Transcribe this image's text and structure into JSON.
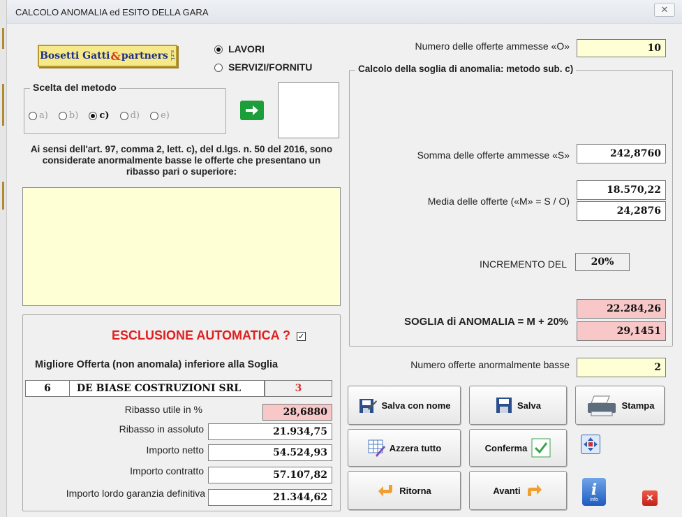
{
  "window": {
    "title": "CALCOLO ANOMALIA ed ESITO DELLA GARA",
    "close_glyph": "✕"
  },
  "logo": {
    "text_main": "Bosetti Gatti",
    "text_amp": "&",
    "text_tail": "partners",
    "text_srl": "s.r.l."
  },
  "tipo": {
    "lavori_label": "LAVORI",
    "servizi_label": "SERVIZI/FORNITU",
    "selected": "LAVORI"
  },
  "metodo": {
    "title": "Scelta del metodo",
    "options": [
      "a)",
      "b)",
      "c)",
      "d)",
      "e)"
    ],
    "selected": "c)"
  },
  "legal_text": "Ai sensi dell'art. 97, comma 2, lett. c), del d.lgs. n. 50 del 2016, sono considerate anormalmente basse le offerte che presentano un ribasso pari o superiore:",
  "esclusione": {
    "title": "ESCLUSIONE AUTOMATICA ?",
    "checked": true,
    "check_glyph": "✓",
    "migliore_label": "Migliore Offerta (non anomala) inferiore alla Soglia",
    "offer_number": "6",
    "company": "DE BIASE COSTRUZIONI SRL",
    "rank": "3",
    "rows": [
      {
        "label": "Ribasso utile in %",
        "value": "28,6880"
      },
      {
        "label": "Ribasso in assoluto",
        "value": "21.934,75"
      },
      {
        "label": "Importo netto",
        "value": "54.524,93"
      },
      {
        "label": "Importo contratto",
        "value": "57.107,82"
      },
      {
        "label": "Importo lordo garanzia definitiva",
        "value": "21.344,62"
      }
    ]
  },
  "right": {
    "numero_offerte_label": "Numero delle offerte ammesse «O»",
    "numero_offerte_value": "10",
    "calc_title": "Calcolo della soglia di anomalia: metodo sub. c)",
    "somma_label": "Somma delle offerte ammesse «S»",
    "somma_value": "242,8760",
    "media_label": "Media delle offerte («M» = S / O)",
    "media_value_1": "18.570,22",
    "media_value_2": "24,2876",
    "incremento_label": "INCREMENTO DEL",
    "incremento_value": "20%",
    "soglia_label": "SOGLIA di ANOMALIA = M + 20%",
    "soglia_value_1": "22.284,26",
    "soglia_value_2": "29,1451",
    "anorm_label": "Numero offerte anormalmente basse",
    "anorm_value": "2"
  },
  "buttons": {
    "salva_nome": "Salva con nome",
    "salva": "Salva",
    "stampa": "Stampa",
    "azzera": "Azzera tutto",
    "conferma": "Conferma",
    "ritorna": "Ritorna",
    "avanti": "Avanti",
    "info_text": "Info"
  },
  "colors": {
    "red_title": "#e02020",
    "yellow_field": "#ffffd6",
    "pink_field": "#f8c8c8",
    "green_arrow": "#1e9e3a"
  }
}
